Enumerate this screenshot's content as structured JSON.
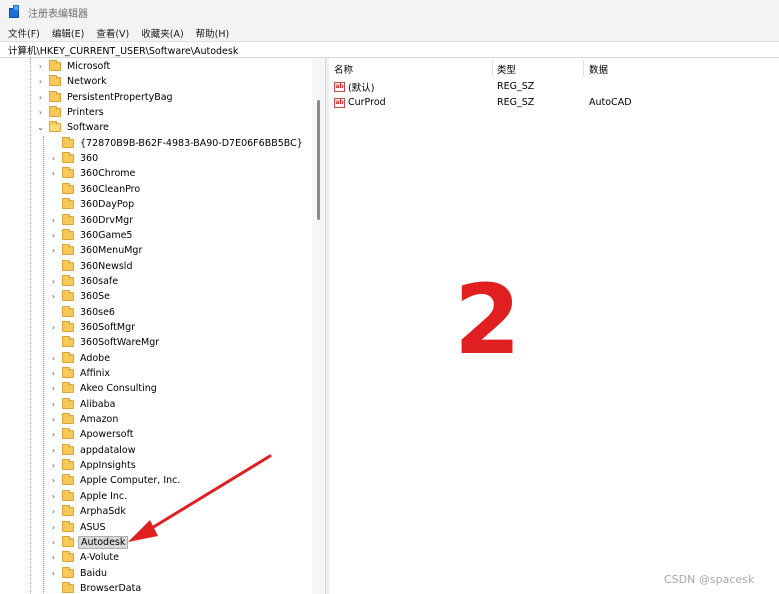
{
  "titlebar": {
    "title": "注册表编辑器",
    "icon": "registry-editor-icon"
  },
  "menubar": {
    "items": [
      "文件(F)",
      "编辑(E)",
      "查看(V)",
      "收藏夹(A)",
      "帮助(H)"
    ]
  },
  "address": {
    "path": "计算机\\HKEY_CURRENT_USER\\Software\\Autodesk"
  },
  "tree": {
    "top_items": [
      {
        "label": "Microsoft",
        "expander": "›"
      },
      {
        "label": "Network",
        "expander": "›"
      },
      {
        "label": "PersistentPropertyBag",
        "expander": "›"
      },
      {
        "label": "Printers",
        "expander": "›"
      },
      {
        "label": "Software",
        "expander": "⌄"
      }
    ],
    "software_children": [
      {
        "label": "{72870B9B-B62F-4983-BA90-D7E06F6BB5BC}",
        "expander": ""
      },
      {
        "label": "360",
        "expander": "›"
      },
      {
        "label": "360Chrome",
        "expander": "›"
      },
      {
        "label": "360CleanPro",
        "expander": ""
      },
      {
        "label": "360DayPop",
        "expander": ""
      },
      {
        "label": "360DrvMgr",
        "expander": "›"
      },
      {
        "label": "360Game5",
        "expander": "›"
      },
      {
        "label": "360MenuMgr",
        "expander": "›"
      },
      {
        "label": "360Newsld",
        "expander": ""
      },
      {
        "label": "360safe",
        "expander": "›"
      },
      {
        "label": "360Se",
        "expander": "›"
      },
      {
        "label": "360se6",
        "expander": ""
      },
      {
        "label": "360SoftMgr",
        "expander": "›"
      },
      {
        "label": "360SoftWareMgr",
        "expander": ""
      },
      {
        "label": "Adobe",
        "expander": "›"
      },
      {
        "label": "Affinix",
        "expander": "›"
      },
      {
        "label": "Akeo Consulting",
        "expander": "›"
      },
      {
        "label": "Alibaba",
        "expander": "›"
      },
      {
        "label": "Amazon",
        "expander": "›"
      },
      {
        "label": "Apowersoft",
        "expander": "›"
      },
      {
        "label": "appdatalow",
        "expander": "›"
      },
      {
        "label": "AppInsights",
        "expander": "›"
      },
      {
        "label": "Apple Computer, Inc.",
        "expander": "›"
      },
      {
        "label": "Apple Inc.",
        "expander": "›"
      },
      {
        "label": "ArphaSdk",
        "expander": "›"
      },
      {
        "label": "ASUS",
        "expander": "›"
      },
      {
        "label": "Autodesk",
        "expander": "›",
        "selected": true
      },
      {
        "label": "A-Volute",
        "expander": "›"
      },
      {
        "label": "Baidu",
        "expander": "›"
      },
      {
        "label": "BrowserData",
        "expander": ""
      }
    ]
  },
  "values": {
    "headers": {
      "name": "名称",
      "type": "类型",
      "data": "数据"
    },
    "rows": [
      {
        "name": "(默认)",
        "type": "REG_SZ",
        "data": ""
      },
      {
        "name": "CurProd",
        "type": "REG_SZ",
        "data": "AutoCAD"
      }
    ],
    "value_icon_text": "ab"
  },
  "annotation": {
    "step_number": "2",
    "arrow_color": "#e02020"
  },
  "watermark": {
    "text": "CSDN @spacesk"
  },
  "colors": {
    "accent": "#1e6fd9",
    "folder": "#f8c955",
    "annotation": "#e02020"
  }
}
